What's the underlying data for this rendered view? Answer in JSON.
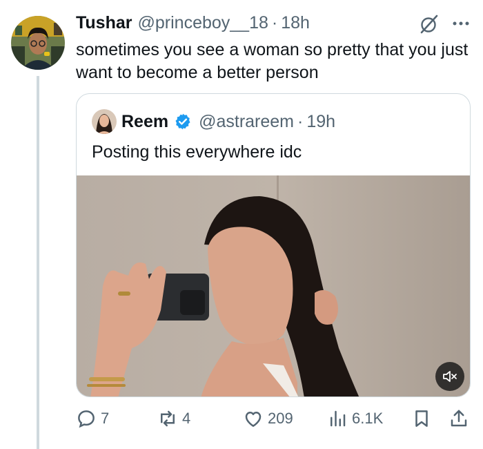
{
  "tweet": {
    "author_name": "Tushar",
    "author_handle": "@princeboy__18",
    "separator": "·",
    "time": "18h",
    "text": "sometimes you see a woman so pretty that you just want to become a better person"
  },
  "quoted": {
    "author_name": "Reem",
    "author_handle": "@astrareem",
    "separator": "·",
    "time": "19h",
    "text": "Posting this everywhere idc"
  },
  "actions": {
    "replies": "7",
    "reposts": "4",
    "likes": "209",
    "views": "6.1K"
  },
  "colors": {
    "text": "#0f1419",
    "muted": "#536471",
    "border": "#cfd9de",
    "verified": "#1d9bf0"
  },
  "icons": [
    "grok-icon",
    "more-icon",
    "verified-badge-icon",
    "mute-icon",
    "reply-icon",
    "repost-icon",
    "like-icon",
    "views-icon",
    "bookmark-icon",
    "share-icon"
  ]
}
